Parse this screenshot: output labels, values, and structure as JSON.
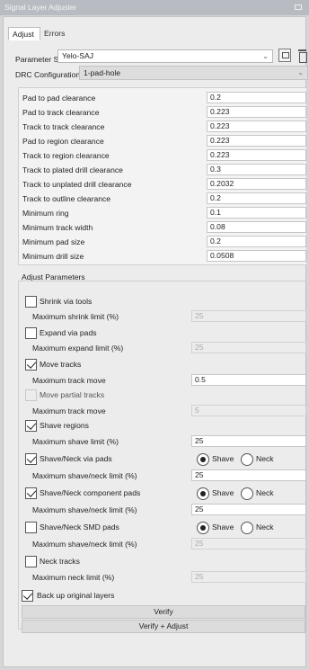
{
  "window": {
    "title": "Signal Layer Adjuster"
  },
  "tabs": [
    {
      "label": "Adjust",
      "active": true
    },
    {
      "label": "Errors",
      "active": false
    }
  ],
  "parameter_set": {
    "label": "Parameter Set",
    "value": "Yelo-SAJ"
  },
  "drc": {
    "label": "DRC Configuration",
    "value": "1-pad-hole"
  },
  "clearances": [
    {
      "label": "Pad to pad clearance",
      "value": "0.2"
    },
    {
      "label": "Pad to track clearance",
      "value": "0.223"
    },
    {
      "label": "Track to track clearance",
      "value": "0.223"
    },
    {
      "label": "Pad to region clearance",
      "value": "0.223"
    },
    {
      "label": "Track to region clearance",
      "value": "0.223"
    },
    {
      "label": "Track to plated drill clearance",
      "value": "0.3"
    },
    {
      "label": "Track to unplated drill clearance",
      "value": "0.2032"
    },
    {
      "label": "Track to outline clearance",
      "value": "0.2"
    },
    {
      "label": "Minimum ring",
      "value": "0.1"
    },
    {
      "label": "Minimum track width",
      "value": "0.08"
    },
    {
      "label": "Minimum pad size",
      "value": "0.2"
    },
    {
      "label": "Minimum drill size",
      "value": "0.0508"
    }
  ],
  "adjust": {
    "heading": "Adjust Parameters",
    "shrink_via_tools": {
      "label": "Shrink via tools",
      "checked": false
    },
    "max_shrink": {
      "label": "Maximum shrink limit (%)",
      "value": "25"
    },
    "expand_via_pads": {
      "label": "Expand via pads",
      "checked": false
    },
    "max_expand": {
      "label": "Maximum expand limit (%)",
      "value": "25"
    },
    "move_tracks": {
      "label": "Move tracks",
      "checked": true
    },
    "max_track_move": {
      "label": "Maximum track move",
      "value": "0.5"
    },
    "move_partial_tracks": {
      "label": "Move partial tracks",
      "checked": false
    },
    "max_track_move_2": {
      "label": "Maximum track move",
      "value": "5"
    },
    "shave_regions": {
      "label": "Shave regions",
      "checked": true
    },
    "max_shave": {
      "label": "Maximum shave limit (%)",
      "value": "25"
    },
    "shave_neck_via_pads": {
      "label": "Shave/Neck via pads",
      "checked": true
    },
    "max_shave_neck_1": {
      "label": "Maximum shave/neck limit (%)",
      "value": "25"
    },
    "shave_neck_component_pads": {
      "label": "Shave/Neck component pads",
      "checked": true
    },
    "max_shave_neck_2": {
      "label": "Maximum shave/neck limit (%)",
      "value": "25"
    },
    "shave_neck_smd_pads": {
      "label": "Shave/Neck SMD pads",
      "checked": false
    },
    "max_shave_neck_3": {
      "label": "Maximum shave/neck limit (%)",
      "value": "25"
    },
    "neck_tracks": {
      "label": "Neck tracks",
      "checked": false
    },
    "max_neck": {
      "label": "Maximum neck limit (%)",
      "value": "25"
    },
    "radio_shave": "Shave",
    "radio_neck": "Neck"
  },
  "backup": {
    "label": "Back up original layers",
    "checked": true
  },
  "buttons": {
    "verify": "Verify",
    "verify_adjust": "Verify + Adjust"
  },
  "icons": {
    "save": "save-icon",
    "delete": "trash-icon",
    "dropdown": "chevron-down-icon"
  }
}
